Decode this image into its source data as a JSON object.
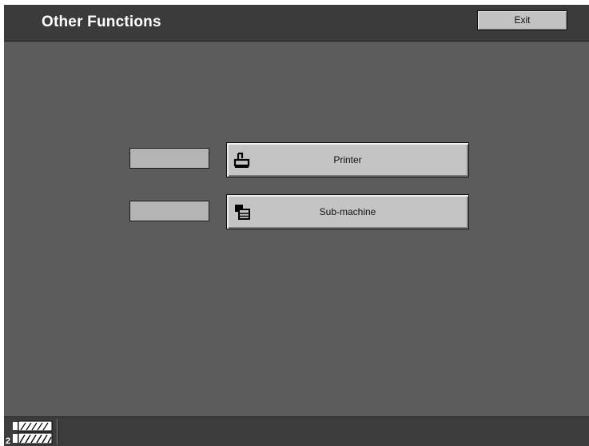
{
  "header": {
    "title": "Other Functions",
    "exit_label": "Exit"
  },
  "functions": [
    {
      "label": "Printer",
      "icon": "printer-icon",
      "status": ""
    },
    {
      "label": "Sub-machine",
      "icon": "sub-machine-icon",
      "status": ""
    }
  ],
  "footer": {
    "tray_icon": "paper-tray-icon",
    "tray_number": "2"
  },
  "colors": {
    "background": "#5c5c5c",
    "header": "#3b3b3b",
    "button": "#c4c4c4",
    "status_box": "#b4b4b4",
    "title_text": "#ffffff"
  }
}
